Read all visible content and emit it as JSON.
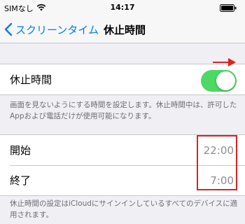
{
  "status_bar": {
    "carrier": "SIMなし",
    "time": "14:17",
    "wifi_icon": "wifi-icon",
    "battery_icon": "battery-icon"
  },
  "nav": {
    "back_label": "スクリーンタイム",
    "title": "休止時間"
  },
  "downtime": {
    "label": "休止時間",
    "enabled": true,
    "description": "画面を見ないようにする時間を設定します。休止時間中は、許可したAppおよび電話だけが使用可能になります。"
  },
  "schedule": {
    "start_label": "開始",
    "start_value": "22:00",
    "end_label": "終了",
    "end_value": "7:00"
  },
  "footer": {
    "note": "休止時間の設定はiCloudにサインインしているすべてのデバイスに適用されます。"
  },
  "colors": {
    "accent": "#007aff",
    "toggle_on": "#4cd964",
    "annotation_red": "#e02020",
    "background": "#efeff4"
  }
}
